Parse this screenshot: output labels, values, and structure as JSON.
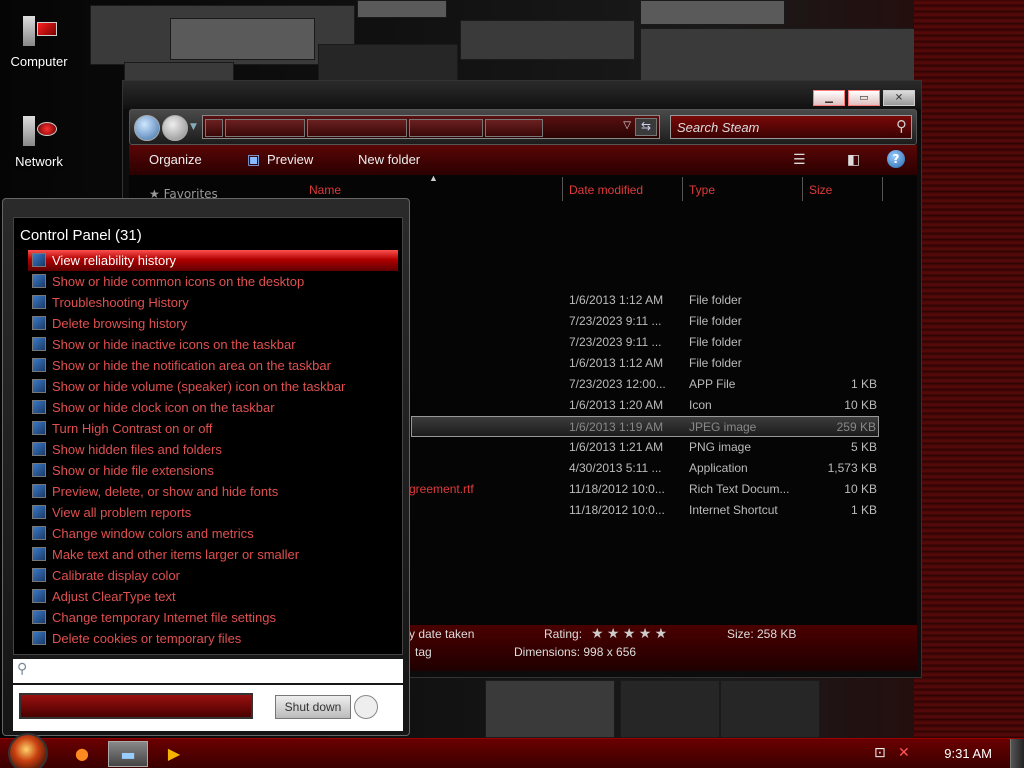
{
  "desktop": {
    "icons": [
      {
        "label": "Computer",
        "icon": "computer-icon"
      },
      {
        "label": "Network",
        "icon": "network-icon"
      }
    ]
  },
  "explorer": {
    "search_placeholder": "Search Steam",
    "toolbar": {
      "organize": "Organize",
      "preview": "Preview",
      "new_folder": "New folder"
    },
    "favorites_label": "Favorites",
    "columns": {
      "name": "Name",
      "date": "Date modified",
      "type": "Type",
      "size": "Size"
    },
    "files": [
      {
        "name": "",
        "date": "1/6/2013 1:12 AM",
        "type": "File folder",
        "size": ""
      },
      {
        "name": "",
        "date": "7/23/2023 9:11 ...",
        "type": "File folder",
        "size": ""
      },
      {
        "name": "",
        "date": "7/23/2023 9:11 ...",
        "type": "File folder",
        "size": ""
      },
      {
        "name": "",
        "date": "1/6/2013 1:12 AM",
        "type": "File folder",
        "size": ""
      },
      {
        "name": "",
        "date": "7/23/2023 12:00...",
        "type": "APP File",
        "size": "1 KB"
      },
      {
        "name": "",
        "date": "1/6/2013 1:20 AM",
        "type": "Icon",
        "size": "10 KB"
      },
      {
        "name": "",
        "date": "1/6/2013 1:19 AM",
        "type": "JPEG image",
        "size": "259 KB",
        "selected": true
      },
      {
        "name": "",
        "date": "1/6/2013 1:21 AM",
        "type": "PNG image",
        "size": "5 KB"
      },
      {
        "name": "",
        "date": "4/30/2013 5:11 ...",
        "type": "Application",
        "size": "1,573 KB"
      },
      {
        "name": "greement.rtf",
        "date": "11/18/2012 10:0...",
        "type": "Rich Text Docum...",
        "size": "10 KB"
      },
      {
        "name": "",
        "date": "11/18/2012 10:0...",
        "type": "Internet Shortcut",
        "size": "1 KB"
      }
    ],
    "details": {
      "date_taken": "y date taken",
      "rating_label": "Rating:",
      "size": "Size: 258 KB",
      "tag": "tag",
      "dimensions": "Dimensions: 998 x 656"
    }
  },
  "start_menu": {
    "group_title": "Control Panel (31)",
    "items": [
      {
        "label": "View reliability history",
        "icon": "flag-icon",
        "highlighted": true
      },
      {
        "label": "Show or hide common icons on the desktop",
        "icon": "display-icon"
      },
      {
        "label": "Troubleshooting History",
        "icon": "troubleshoot-icon"
      },
      {
        "label": "Delete browsing history",
        "icon": "internet-options-icon"
      },
      {
        "label": "Show or hide inactive icons on the taskbar",
        "icon": "taskbar-icon"
      },
      {
        "label": "Show or hide the notification area on the taskbar",
        "icon": "taskbar-icon"
      },
      {
        "label": "Show or hide volume (speaker) icon on the taskbar",
        "icon": "taskbar-icon"
      },
      {
        "label": "Show or hide clock icon on the taskbar",
        "icon": "taskbar-icon"
      },
      {
        "label": "Turn High Contrast on or off",
        "icon": "ease-of-access-icon"
      },
      {
        "label": "Show hidden files and folders",
        "icon": "folder-options-icon"
      },
      {
        "label": "Show or hide file extensions",
        "icon": "folder-options-icon"
      },
      {
        "label": "Preview, delete, or show and hide fonts",
        "icon": "fonts-icon"
      },
      {
        "label": "View all problem reports",
        "icon": "flag-icon"
      },
      {
        "label": "Change window colors and metrics",
        "icon": "display-icon"
      },
      {
        "label": "Make text and other items larger or smaller",
        "icon": "display-icon"
      },
      {
        "label": "Calibrate display color",
        "icon": "display-icon"
      },
      {
        "label": "Adjust ClearType text",
        "icon": "display-icon"
      },
      {
        "label": "Change temporary Internet file settings",
        "icon": "internet-options-icon"
      },
      {
        "label": "Delete cookies or temporary files",
        "icon": "internet-options-icon"
      }
    ],
    "shutdown_label": "Shut down"
  },
  "taskbar": {
    "clock": "9:31 AM",
    "apps": [
      "firefox-icon",
      "explorer-icon",
      "media-player-icon"
    ]
  },
  "colors": {
    "accent": "#e03a3a",
    "highlight": "#b00000"
  }
}
